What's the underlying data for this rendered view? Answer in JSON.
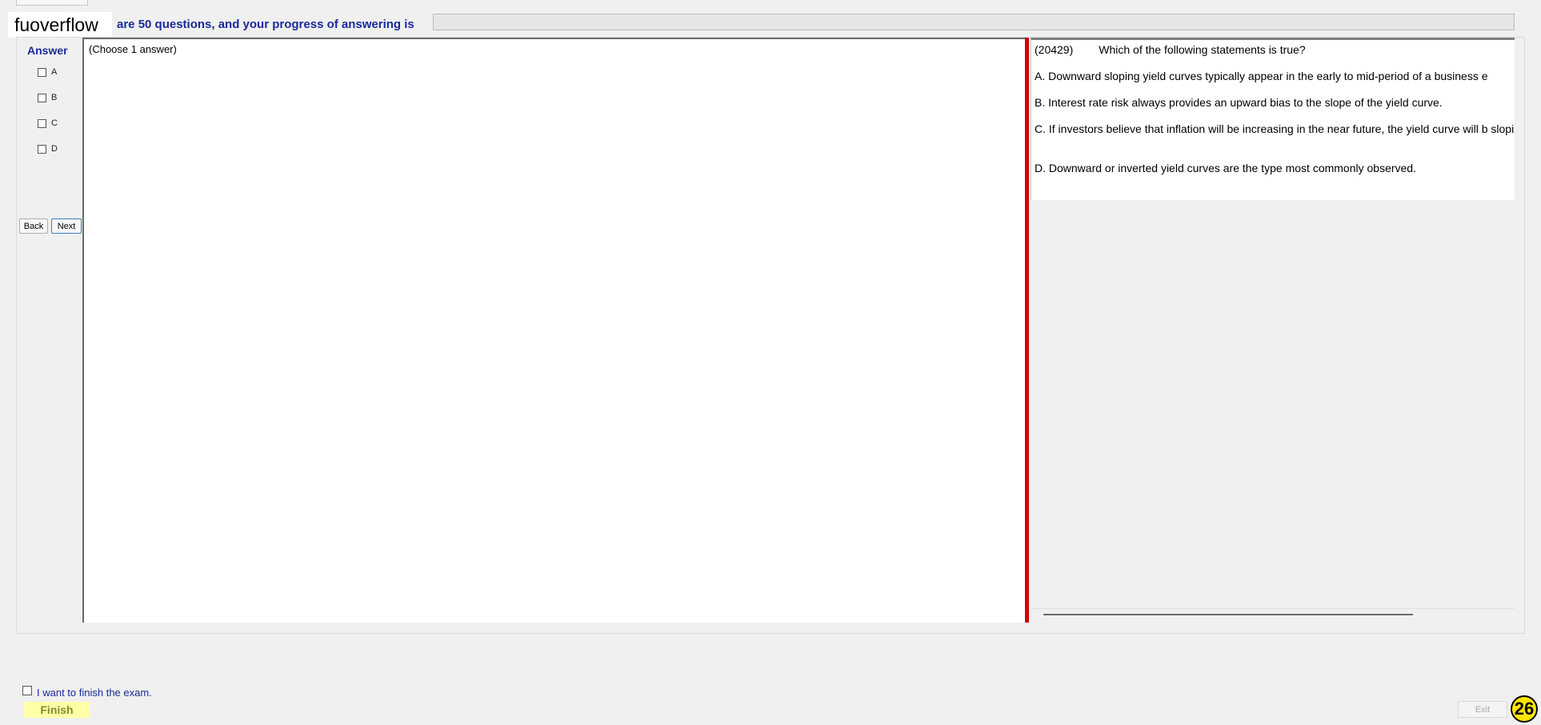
{
  "header": {
    "brand": "fuoverflow",
    "progress_text": "are 50 questions, and your progress of answering is"
  },
  "answer_panel": {
    "title": "Answer",
    "options": [
      "A",
      "B",
      "C",
      "D"
    ],
    "back_label": "Back",
    "next_label": "Next"
  },
  "answer_area": {
    "instruction": "(Choose 1 answer)"
  },
  "question": {
    "id": "(20429)",
    "text": "Which of the following statements is true?",
    "options": [
      "A.  Downward sloping yield curves typically appear in the early to mid-period of a business e",
      "B.  Interest rate risk always provides an upward bias to the slope of the yield curve.",
      "C.  If investors believe that inflation will be increasing in the near future, the yield curve will b sloping.",
      "D.  Downward or inverted yield curves are the type most commonly observed."
    ]
  },
  "footer": {
    "finish_checkbox_label": "I want to finish the exam.",
    "finish_label": "Finish",
    "exit_label": "Exit",
    "badge": "26"
  }
}
